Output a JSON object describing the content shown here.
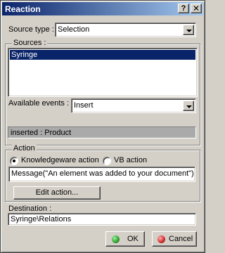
{
  "window": {
    "title": "Reaction",
    "help_glyph": "?",
    "close_glyph": "✕"
  },
  "source_type": {
    "label": "Source type :",
    "value": "Selection"
  },
  "sources": {
    "legend": "Sources :",
    "items": [
      "Syringe"
    ],
    "selected_index": 0
  },
  "available_events": {
    "label": "Available events :",
    "value": "Insert"
  },
  "status": {
    "text": "inserted :   Product"
  },
  "action": {
    "legend": "Action",
    "options": [
      "Knowledgeware action",
      "VB action"
    ],
    "selected_option": "Knowledgeware action",
    "expression": "Message(\"An element was added to your document\")",
    "edit_button": "Edit action..."
  },
  "destination": {
    "label": "Destination :",
    "value": "Syringe\\Relations"
  },
  "buttons": {
    "ok": "OK",
    "cancel": "Cancel"
  },
  "colors": {
    "ok_icon": "#2e9e2e",
    "cancel_icon": "#cc2a2a",
    "selection": "#0a246a"
  }
}
